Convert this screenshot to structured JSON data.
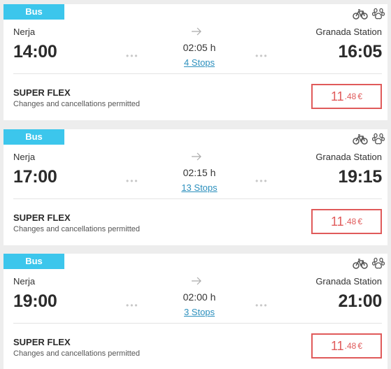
{
  "icons": {
    "bike": "bicycle-icon",
    "pet": "paw-icon",
    "arrow": "arrow-right-icon"
  },
  "colors": {
    "badge": "#3cc6ec",
    "price": "#e05a5a",
    "link": "#2b8fbd"
  },
  "trips": [
    {
      "mode": "Bus",
      "from": "Nerja",
      "to": "Granada Station",
      "departure": "14:00",
      "arrival": "16:05",
      "duration": "02:05 h",
      "stops": "4 Stops",
      "fare_name": "SUPER FLEX",
      "fare_desc": "Changes and cancellations permitted",
      "price_int": "11",
      "price_dec": ".48",
      "currency": "€"
    },
    {
      "mode": "Bus",
      "from": "Nerja",
      "to": "Granada Station",
      "departure": "17:00",
      "arrival": "19:15",
      "duration": "02:15 h",
      "stops": "13 Stops",
      "fare_name": "SUPER FLEX",
      "fare_desc": "Changes and cancellations permitted",
      "price_int": "11",
      "price_dec": ".48",
      "currency": "€"
    },
    {
      "mode": "Bus",
      "from": "Nerja",
      "to": "Granada Station",
      "departure": "19:00",
      "arrival": "21:00",
      "duration": "02:00 h",
      "stops": "3 Stops",
      "fare_name": "SUPER FLEX",
      "fare_desc": "Changes and cancellations permitted",
      "price_int": "11",
      "price_dec": ".48",
      "currency": "€"
    }
  ]
}
